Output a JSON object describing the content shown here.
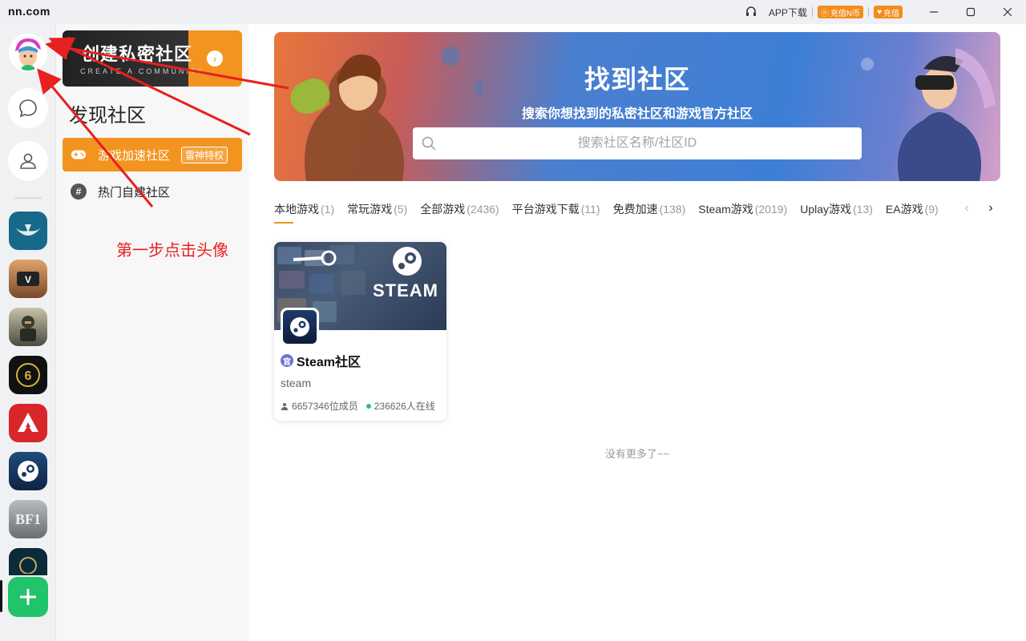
{
  "titlebar": {
    "logo": "nn.com",
    "app_download": "APP下载",
    "recharge_n": "充值N币",
    "recharge": "充值"
  },
  "rail": {
    "games": [
      {
        "name": "warframe-icon",
        "color": "#17698a"
      },
      {
        "name": "gta5-icon",
        "color": "#b8794a"
      },
      {
        "name": "pubg-icon",
        "color": "#8a8a7a"
      },
      {
        "name": "rainbow-six-icon",
        "color": "#111111"
      },
      {
        "name": "apex-icon",
        "color": "#d9262b"
      },
      {
        "name": "steam-icon",
        "color": "#18345a"
      },
      {
        "name": "bf1-icon",
        "color": "#8a8f95"
      },
      {
        "name": "lol-icon",
        "color": "#0b2a3a"
      }
    ],
    "bf1_label": "BF1"
  },
  "panel": {
    "create_banner_title": "创建私密社区",
    "create_banner_sub": "CREATE A COMMUNITY",
    "title": "发现社区",
    "nav": [
      {
        "label": "游戏加速社区",
        "badge": "雷神特权"
      },
      {
        "label": "热门自建社区"
      }
    ]
  },
  "annotation": {
    "text": "第一步点击头像"
  },
  "hero": {
    "title": "找到社区",
    "subtitle": "搜索你想找到的私密社区和游戏官方社区",
    "search_placeholder": "搜索社区名称/社区ID"
  },
  "tabs": [
    {
      "label": "本地游戏",
      "count": "(1)"
    },
    {
      "label": "常玩游戏",
      "count": "(5)"
    },
    {
      "label": "全部游戏",
      "count": "(2436)"
    },
    {
      "label": "平台游戏下载",
      "count": "(11)"
    },
    {
      "label": "免费加速",
      "count": "(138)"
    },
    {
      "label": "Steam游戏",
      "count": "(2019)"
    },
    {
      "label": "Uplay游戏",
      "count": "(13)"
    },
    {
      "label": "EA游戏",
      "count": "(9)"
    }
  ],
  "card": {
    "cover_text": "STEAM",
    "badge": "官",
    "name": "Steam社区",
    "sub": "steam",
    "members": "6657346位成员",
    "online": "236626人在线"
  },
  "footer": {
    "no_more": "没有更多了~~"
  },
  "colors": {
    "accent": "#f49420",
    "add_green": "#21c36b",
    "annotation_red": "#e82020"
  }
}
